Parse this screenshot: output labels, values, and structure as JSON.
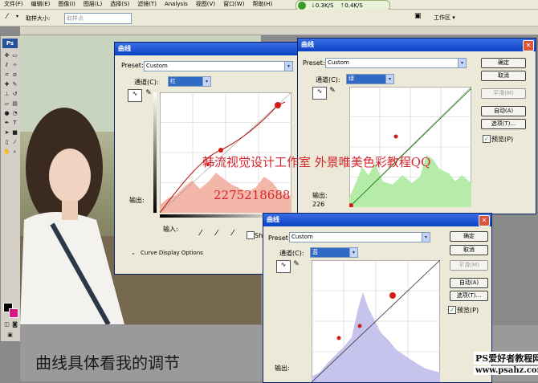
{
  "menubar": {
    "items": [
      "文件(F)",
      "编辑(E)",
      "图像(I)",
      "图层(L)",
      "选择(S)",
      "滤镜(T)",
      "Analysis",
      "视图(V)",
      "窗口(W)",
      "帮助(H)"
    ],
    "network": {
      "down": "0.3K/S",
      "up": "0.4K/S"
    }
  },
  "optionsbar": {
    "sample_label": "取样大小:",
    "sample_value": "取样点",
    "workspace_label": "工作区 ▾"
  },
  "toolbox": {
    "logo": "Ps"
  },
  "overlays": {
    "studio": "韩流视觉设计工作室  外景唯美色彩教程QQ",
    "qq": "2275218688",
    "caption": "曲线具体看我的调节",
    "watermark1": "PS爱好者教程网",
    "watermark2": "www.psahz.com"
  },
  "dialogs": {
    "red": {
      "title": "曲线",
      "preset_label": "Preset:",
      "preset_value": "Custom",
      "channel_label": "通道(C):",
      "channel_value": "红",
      "output_label": "输出:",
      "input_label": "输入:",
      "show_label": "Sho",
      "curve_options": "Curve Display Options"
    },
    "green": {
      "title": "曲线",
      "preset_label": "Preset:",
      "preset_value": "Custom",
      "channel_label": "通道(C):",
      "channel_value": "绿",
      "output_label": "输出:",
      "output_value": "226",
      "ok": "确定",
      "cancel": "取消",
      "smooth": "平滑(M)",
      "auto": "自动(A)",
      "options": "选项(T)...",
      "preview": "预览(P)"
    },
    "blue": {
      "title": "曲线",
      "preset_label": "Preset:",
      "preset_value": "Custom",
      "channel_label": "通道(C):",
      "channel_value": "蓝",
      "output_label": "输出:",
      "ok": "确定",
      "cancel": "取消",
      "smooth": "平滑(M)",
      "auto": "自动(A)",
      "options": "选项(T)...",
      "preview": "预览(P)"
    }
  },
  "colors": {
    "red_hist": "#f2b7a8",
    "green_hist": "#b5ecaa",
    "blue_hist": "#c6c4ec",
    "title_bar": "#0a42c4"
  }
}
